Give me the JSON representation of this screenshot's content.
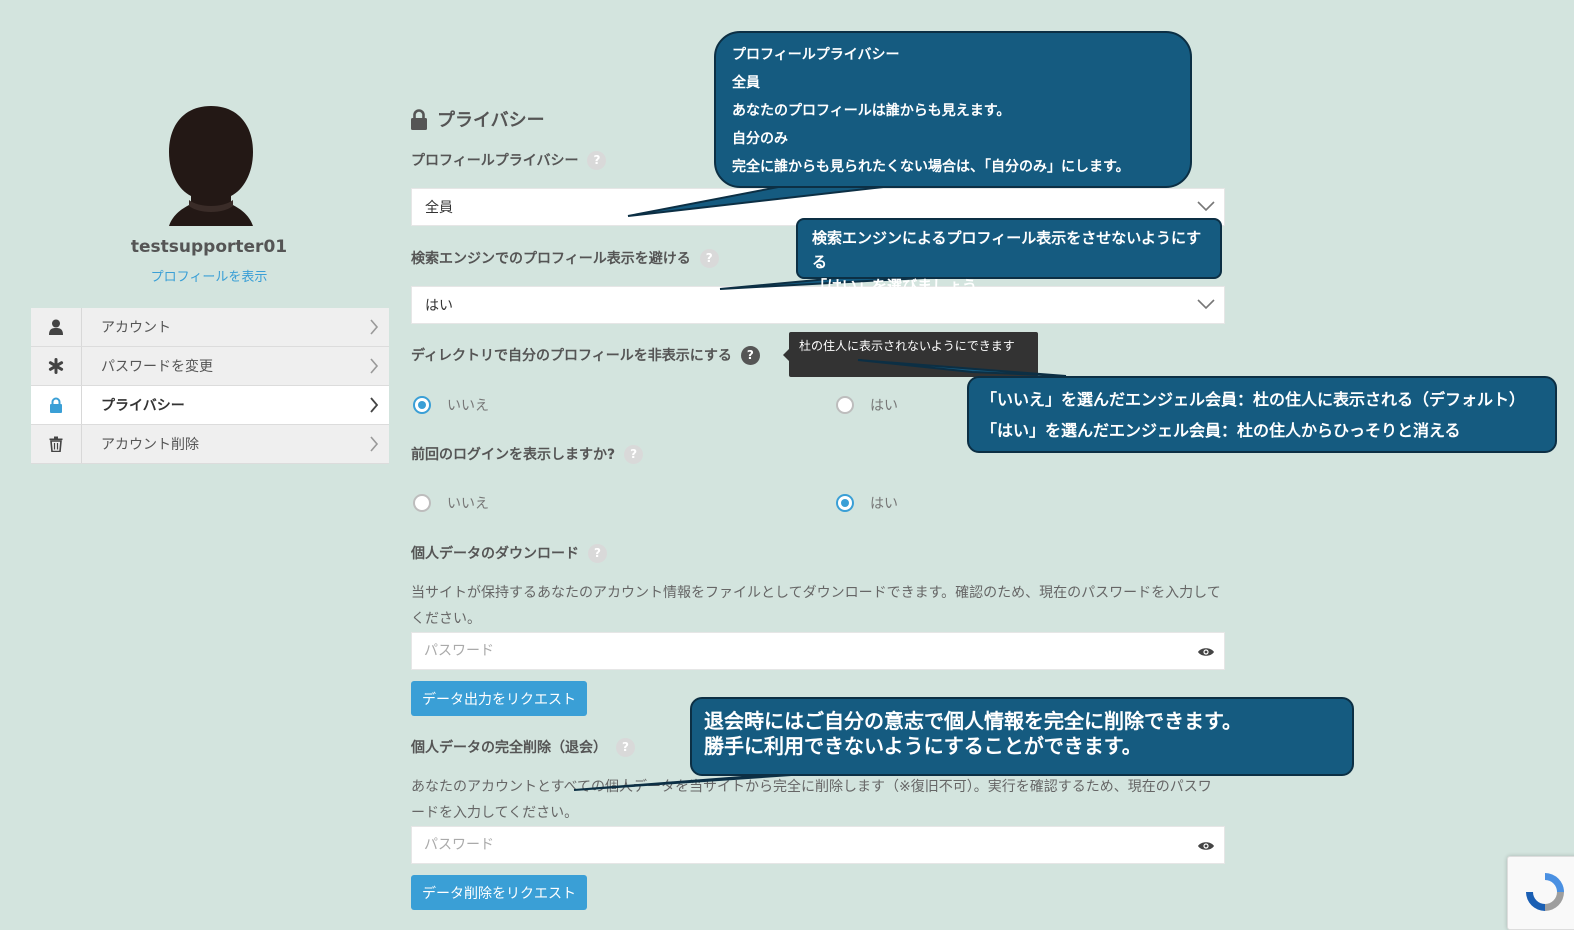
{
  "sidebar": {
    "username": "testsupporter01",
    "view_profile": "プロフィールを表示",
    "items": [
      {
        "label": "アカウント",
        "icon": "user-icon",
        "active": false
      },
      {
        "label": "パスワードを変更",
        "icon": "asterisk-icon",
        "active": false
      },
      {
        "label": "プライバシー",
        "icon": "lock-icon",
        "active": true
      },
      {
        "label": "アカウント削除",
        "icon": "trash-icon",
        "active": false
      }
    ]
  },
  "main": {
    "heading": "プライバシー",
    "profile_privacy": {
      "label": "プロフィールプライバシー",
      "value": "全員"
    },
    "search_engine": {
      "label": "検索エンジンでのプロフィール表示を避ける",
      "value": "はい"
    },
    "directory": {
      "label": "ディレクトリで自分のプロフィールを非表示にする",
      "options": [
        "いいえ",
        "はい"
      ],
      "selected": "いいえ",
      "tooltip": "杜の住人に表示されないようにできます"
    },
    "last_login": {
      "label": "前回のログインを表示しますか?",
      "options": [
        "いいえ",
        "はい"
      ],
      "selected": "はい"
    },
    "download": {
      "label": "個人データのダウンロード",
      "description": "当サイトが保持するあなたのアカウント情報をファイルとしてダウンロードできます。確認のため、現在のパスワードを入力してください。",
      "placeholder": "パスワード",
      "button": "データ出力をリクエスト"
    },
    "erase": {
      "label": "個人データの完全削除（退会）",
      "description": "あなたのアカウントとすべての個人データを当サイトから完全に削除します（※復旧不可）。実行を確認するため、現在のパスワードを入力してください。",
      "placeholder": "パスワード",
      "button": "データ削除をリクエスト"
    }
  },
  "callouts": {
    "privacy": [
      "プロフィールプライバシー",
      "全員",
      "あなたのプロフィールは誰からも見えます。",
      "自分のみ",
      "完全に誰からも見られたくない場合は、「自分のみ」にします。"
    ],
    "search": [
      "検索エンジンによるプロフィール表示をさせないようにする",
      "「はい」を選びましょう。"
    ],
    "directory": [
      "「いいえ」を選んだエンジェル会員：杜の住人に表示される（デフォルト）",
      "「はい」を選んだエンジェル会員：杜の住人からひっそりと消える"
    ],
    "erase": [
      "退会時にはご自分の意志で個人情報を完全に削除できます。",
      "勝手に利用できないようにすることができます。"
    ]
  },
  "colors": {
    "background": "#d3e4de",
    "accent": "#3a9fd6",
    "callout": "#155b80",
    "tooltip": "#333333"
  }
}
